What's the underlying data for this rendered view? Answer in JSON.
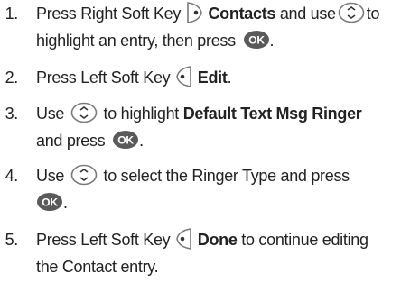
{
  "steps": [
    {
      "number": "1.",
      "t1": "Press Right Soft Key",
      "t2": "Contacts",
      "t3": "and use",
      "t4": "to",
      "t5": "highlight an entry, then press",
      "t6": "."
    },
    {
      "number": "2.",
      "t1": "Press Left Soft Key",
      "t2": "Edit",
      "t3": "."
    },
    {
      "number": "3.",
      "t1": "Use",
      "t2": "to highlight",
      "t3": "Default Text Msg Ringer",
      "t4": "and press",
      "t5": "."
    },
    {
      "number": "4.",
      "t1": "Use",
      "t2": "to select the Ringer Type and press",
      "t3": "."
    },
    {
      "number": "5.",
      "t1": "Press Left Soft Key",
      "t2": "Done",
      "t3": "to continue editing",
      "t4": "the Contact entry."
    }
  ],
  "icons": {
    "ok_key": "OK",
    "right_soft_key": "right-soft-key-icon",
    "left_soft_key": "left-soft-key-icon",
    "nav_key": "navigation-key-icon"
  }
}
